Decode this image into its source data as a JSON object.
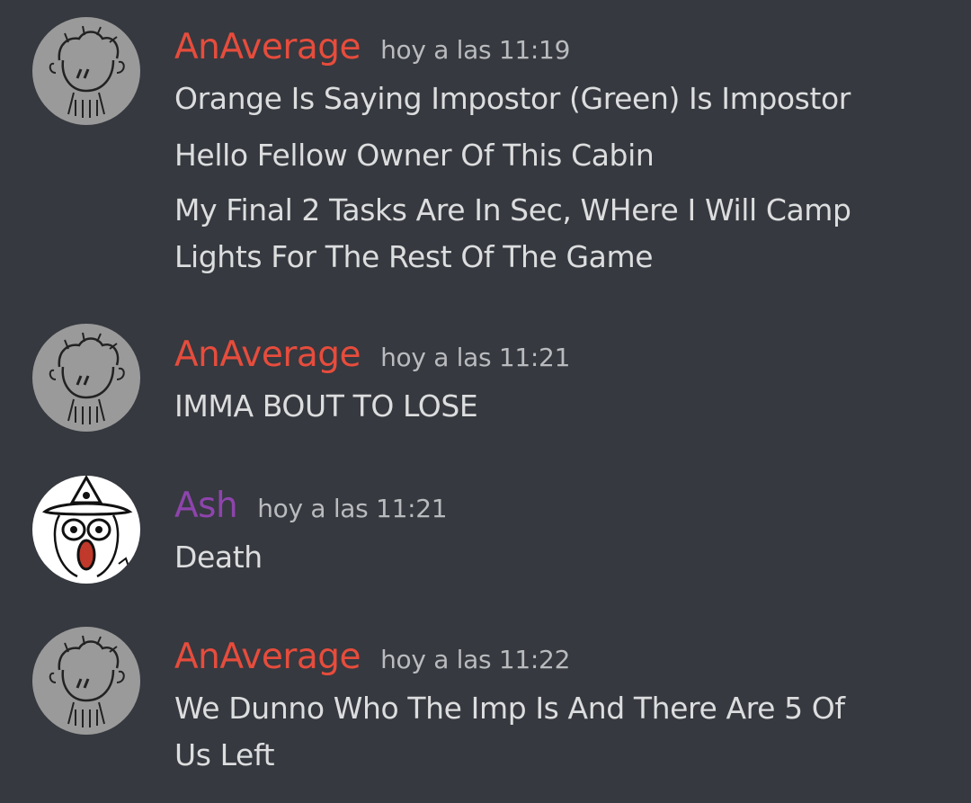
{
  "colors": {
    "background": "#36393f",
    "username_anaverage": "#e74c3c",
    "username_ash": "#8e44ad",
    "timestamp": "#b9bbbe",
    "text": "#dcddde"
  },
  "messages": [
    {
      "username": "AnAverage",
      "timestamp": "hoy a las 11:19",
      "avatar_icon": "sketch-character-avatar-icon",
      "lines": [
        "Orange Is Saying Impostor (Green) Is Impostor",
        "Hello Fellow Owner Of This Cabin",
        "My Final 2 Tasks Are In Sec, WHere I Will Camp",
        "Lights For The Rest Of The Game"
      ]
    },
    {
      "username": "AnAverage",
      "timestamp": "hoy a las 11:21",
      "avatar_icon": "sketch-character-avatar-icon",
      "lines": [
        "IMMA BOUT TO LOSE"
      ]
    },
    {
      "username": "Ash",
      "timestamp": "hoy a las 11:21",
      "avatar_icon": "screaming-character-avatar-icon",
      "lines": [
        "Death"
      ]
    },
    {
      "username": "AnAverage",
      "timestamp": "hoy a las 11:22",
      "avatar_icon": "sketch-character-avatar-icon",
      "lines": [
        "We Dunno Who The Imp Is And There Are 5 Of",
        "Us Left"
      ]
    }
  ]
}
